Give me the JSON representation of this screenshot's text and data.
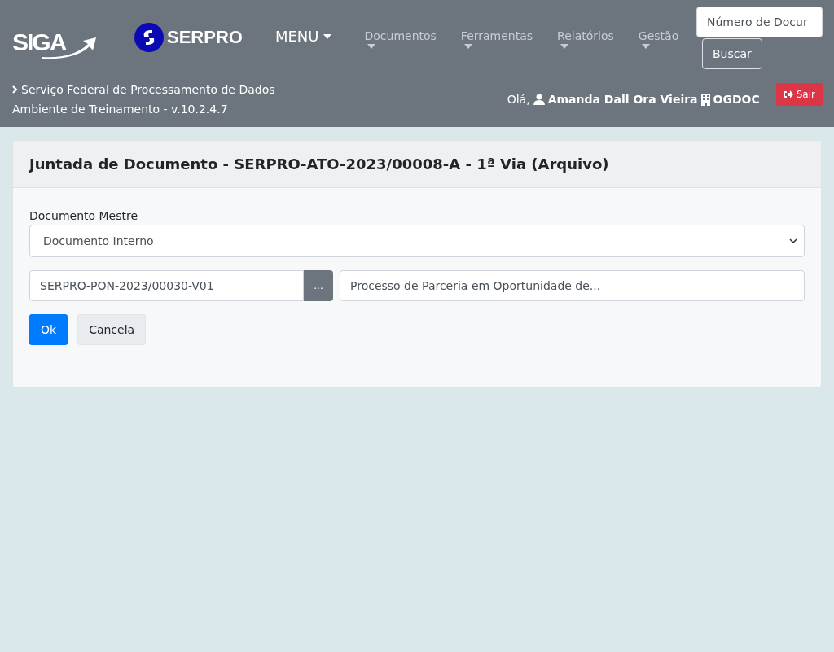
{
  "header": {
    "logo_text": "SIGA",
    "brand_text": "SERPRO",
    "menu_label": "MENU",
    "nav_items": [
      {
        "label": "Documentos"
      },
      {
        "label": "Ferramentas"
      },
      {
        "label": "Relatórios"
      },
      {
        "label": "Gestão"
      }
    ],
    "search": {
      "placeholder": "Número de Docur"
    },
    "search_button": "Buscar",
    "organization": "Serviço Federal de Processamento de Dados",
    "environment": "Ambiente de Treinamento - v.10.2.4.7",
    "greeting": "Olá,",
    "user_name": "Amanda Dall Ora Vieira",
    "unit": "OGDOC",
    "logout_button": "Sair"
  },
  "card": {
    "title": "Juntada de Documento - SERPRO-ATO-2023/00008-A - 1ª Via (Arquivo)",
    "master_label": "Documento Mestre",
    "master_select": "Documento Interno",
    "document_code": "SERPRO-PON-2023/00030-V01",
    "browse_button": "...",
    "document_description": "Processo de Parceria em Oportunidade de...",
    "buttons": [
      {
        "label": "Ok",
        "kind": "primary"
      },
      {
        "label": "Cancela",
        "kind": "secondary"
      }
    ]
  }
}
